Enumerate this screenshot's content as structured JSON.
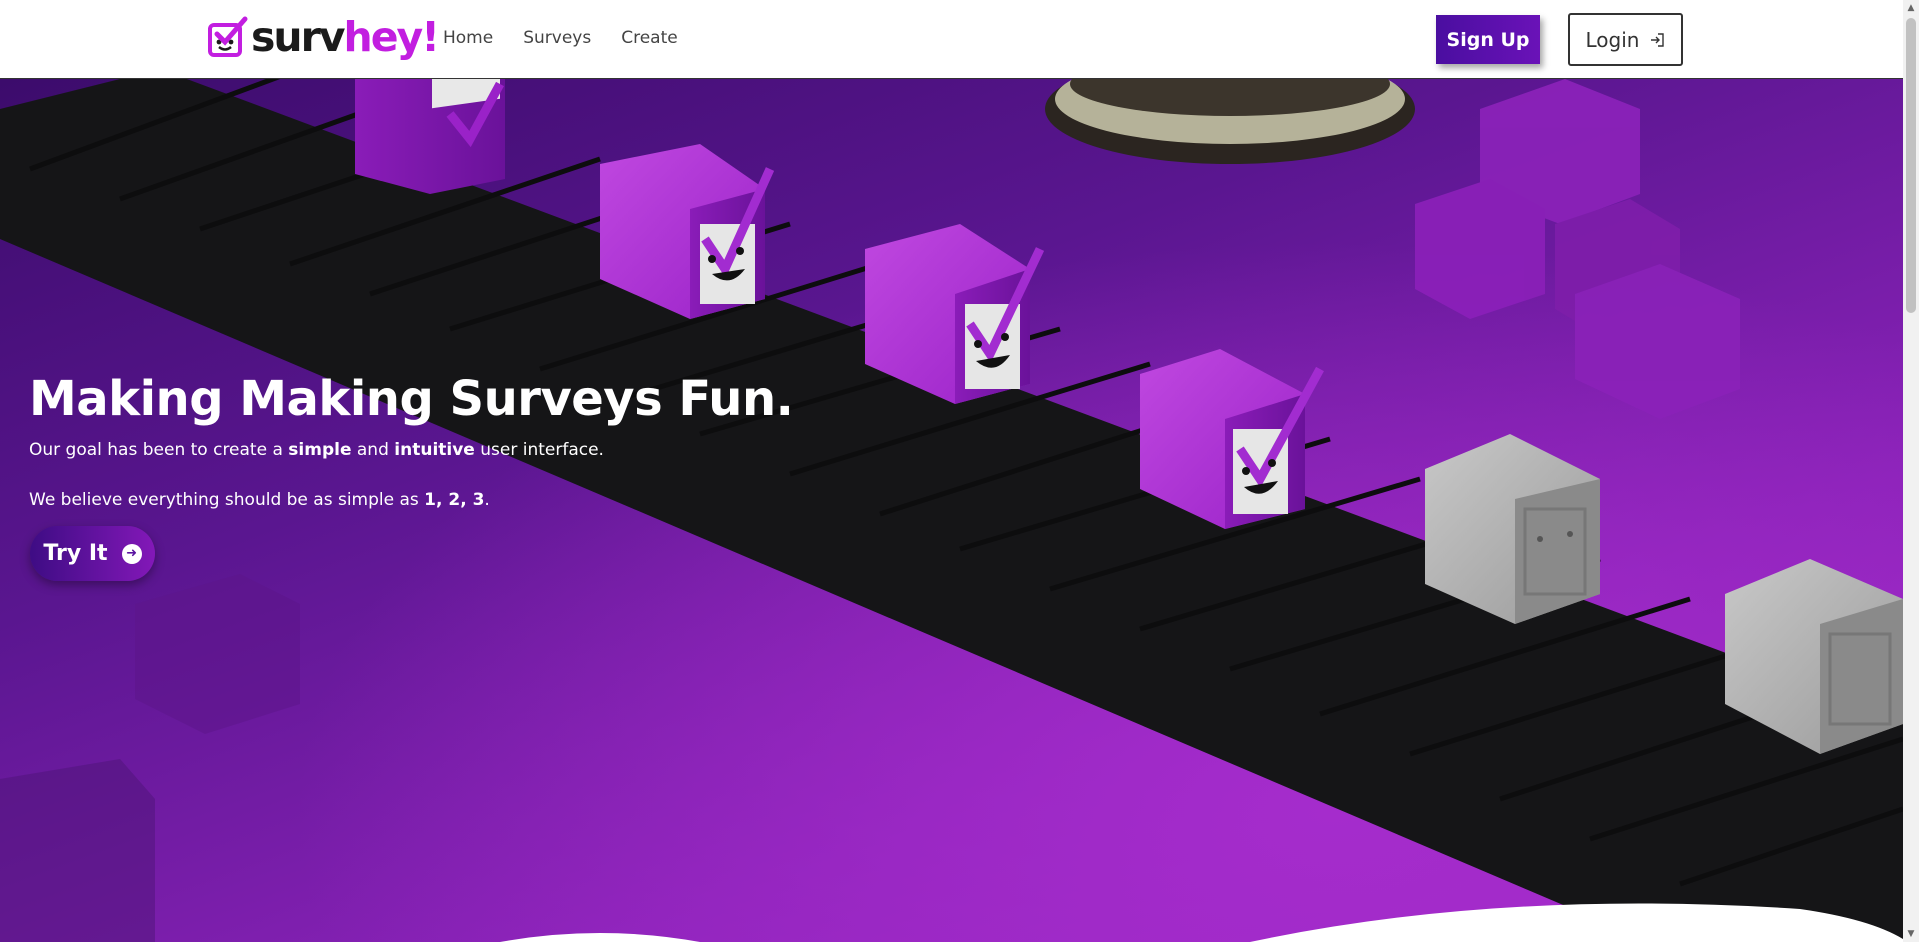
{
  "brand": {
    "name_part1": "surv",
    "name_part2": "hey!"
  },
  "nav": {
    "items": [
      {
        "label": "Home"
      },
      {
        "label": "Surveys"
      },
      {
        "label": "Create"
      }
    ],
    "signup_label": "Sign Up",
    "login_label": "Login"
  },
  "hero": {
    "title": "Making Making Surveys Fun.",
    "line1_pre": "Our goal has been to create a ",
    "line1_b1": "simple",
    "line1_mid": " and ",
    "line1_b2": "intuitive",
    "line1_post": " user interface.",
    "line2_pre": "We believe everything should be as simple as ",
    "line2_b": "1, 2, 3",
    "line2_post": ".",
    "cta_label": "Try It"
  },
  "colors": {
    "brand_accent": "#c21ee0",
    "primary_purple": "#4a0ea0",
    "hero_purple": "#8a22b8"
  },
  "icons": {
    "logo": "checkbox-face-icon",
    "login": "login-arrow-icon",
    "cta": "arrow-right-circle-icon"
  }
}
